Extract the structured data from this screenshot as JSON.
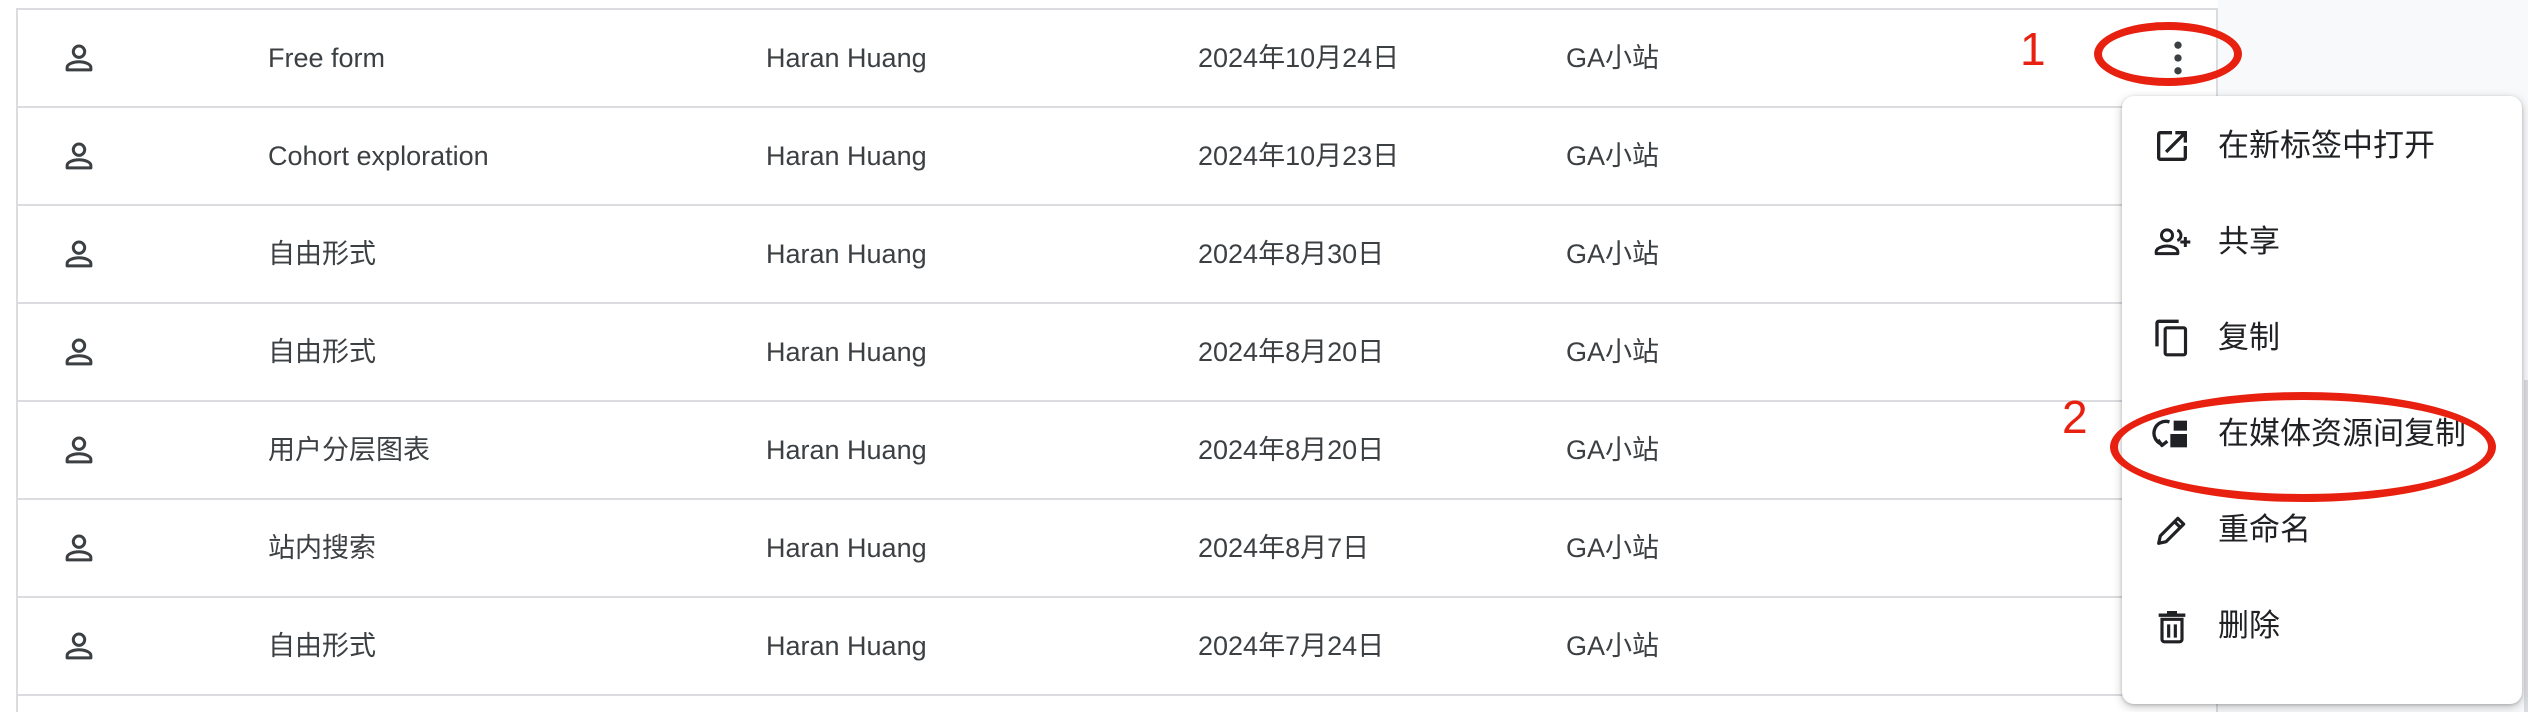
{
  "rows": [
    {
      "name": "Free form",
      "owner": "Haran Huang",
      "date": "2024年10月24日",
      "property": "GA小站"
    },
    {
      "name": "Cohort exploration",
      "owner": "Haran Huang",
      "date": "2024年10月23日",
      "property": "GA小站"
    },
    {
      "name": "自由形式",
      "owner": "Haran Huang",
      "date": "2024年8月30日",
      "property": "GA小站"
    },
    {
      "name": "自由形式",
      "owner": "Haran Huang",
      "date": "2024年8月20日",
      "property": "GA小站"
    },
    {
      "name": "用户分层图表",
      "owner": "Haran Huang",
      "date": "2024年8月20日",
      "property": "GA小站"
    },
    {
      "name": "站内搜索",
      "owner": "Haran Huang",
      "date": "2024年8月7日",
      "property": "GA小站"
    },
    {
      "name": "自由形式",
      "owner": "Haran Huang",
      "date": "2024年7月24日",
      "property": "GA小站"
    }
  ],
  "menu": {
    "items": [
      {
        "label": "在新标签中打开",
        "icon": "open-in-new-icon"
      },
      {
        "label": "共享",
        "icon": "person-add-icon"
      },
      {
        "label": "复制",
        "icon": "copy-icon"
      },
      {
        "label": "在媒体资源间复制",
        "icon": "copy-across-property-icon"
      },
      {
        "label": "重命名",
        "icon": "pencil-icon"
      },
      {
        "label": "删除",
        "icon": "trash-icon"
      }
    ]
  },
  "annotations": {
    "step1": "1",
    "step2": "2",
    "color": "#e8200f"
  },
  "colors": {
    "text": "#3c4043",
    "divider": "#dadce0",
    "menu_text": "#202124"
  }
}
